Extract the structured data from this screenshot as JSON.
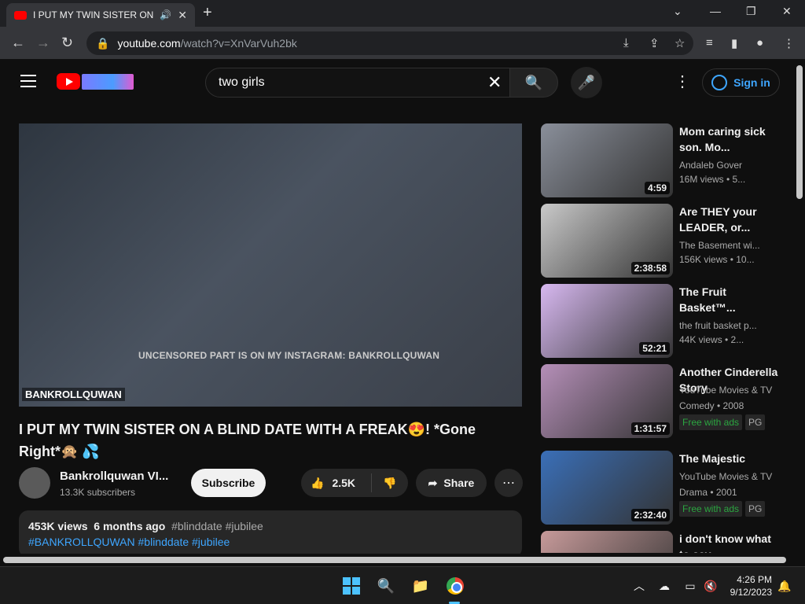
{
  "browser": {
    "tab_title": "I PUT MY TWIN SISTER ON A",
    "new_tab": "+",
    "url_host": "youtube.com",
    "url_path": "/watch?v=XnVarVuh2bk"
  },
  "header": {
    "search_value": "two girls",
    "sign_in": "Sign in"
  },
  "player": {
    "overlay_text": "UNCENSORED PART IS ON MY INSTAGRAM: BANKROLLQUWAN",
    "handle": "BANKROLLQUWAN"
  },
  "video": {
    "title": "I PUT MY TWIN SISTER ON A BLIND DATE WITH A FREAK😍! *Gone Right*🙊 💦",
    "channel": "Bankrollquwan VI...",
    "subscribers": "13.3K subscribers",
    "subscribe": "Subscribe",
    "likes": "2.5K",
    "share": "Share",
    "views": "453K views",
    "age": "6 months ago",
    "tagline": "#blinddate #jubilee",
    "tags": "#BANKROLLQUWAN #blinddate #jubilee"
  },
  "recommendations": [
    {
      "title": "Mom caring sick son. Mo...",
      "channel": "Andaleb Gover",
      "stats": "16M views  • 5...",
      "duration": "4:59",
      "color": "#8a8f9a"
    },
    {
      "title": "Are THEY your LEADER, or...",
      "channel": "The Basement wi...",
      "stats": "156K views  • 10...",
      "duration": "2:38:58",
      "color": "#c9c9c9"
    },
    {
      "title": "The Fruit Basket™...",
      "channel": "the fruit basket p...",
      "stats": "44K views  • 2...",
      "duration": "52:21",
      "color": "#d7b8f0"
    },
    {
      "title": "Another Cinderella Story",
      "channel": "YouTube Movies & TV",
      "stats": "Comedy • 2008",
      "duration": "1:31:57",
      "color": "#b58fb8",
      "badge": "Free with ads",
      "rating": "PG"
    },
    {
      "title": "The Majestic",
      "channel": "YouTube Movies & TV",
      "stats": "Drama • 2001",
      "duration": "2:32:40",
      "color": "#3a6fb8",
      "badge": "Free with ads",
      "rating": "PG"
    },
    {
      "title": "i don't know what to say",
      "channel": "",
      "stats": "",
      "duration": "",
      "color": "#c79a9a"
    }
  ],
  "taskbar": {
    "time": "4:26 PM",
    "date": "9/12/2023"
  }
}
